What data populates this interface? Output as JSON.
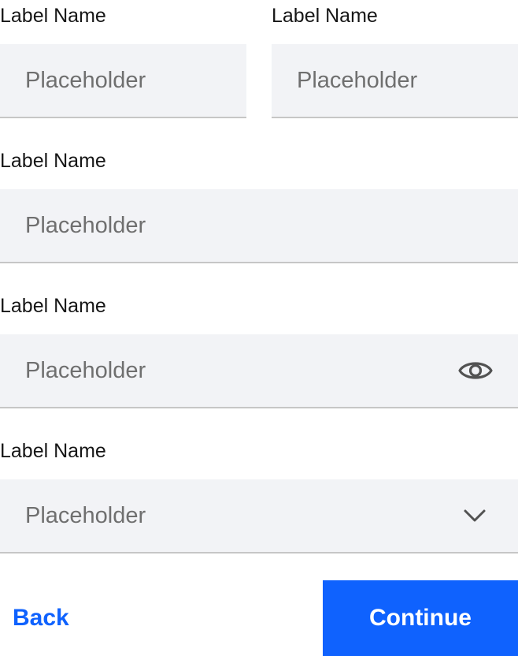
{
  "form": {
    "row1": {
      "left": {
        "label": "Label Name",
        "placeholder": "Placeholder"
      },
      "right": {
        "label": "Label Name",
        "placeholder": "Placeholder"
      }
    },
    "text_field": {
      "label": "Label Name",
      "placeholder": "Placeholder"
    },
    "password_field": {
      "label": "Label Name",
      "placeholder": "Placeholder",
      "icon": "eye-icon"
    },
    "select_field": {
      "label": "Label Name",
      "selected": "Placeholder",
      "icon": "chevron-down-icon"
    }
  },
  "actions": {
    "back_label": "Back",
    "continue_label": "Continue"
  },
  "colors": {
    "primary": "#0f62fe",
    "field_background": "#f2f3f6",
    "field_border": "#c6c6c6",
    "placeholder_text": "#6f6f6f",
    "label_text": "#161616"
  }
}
